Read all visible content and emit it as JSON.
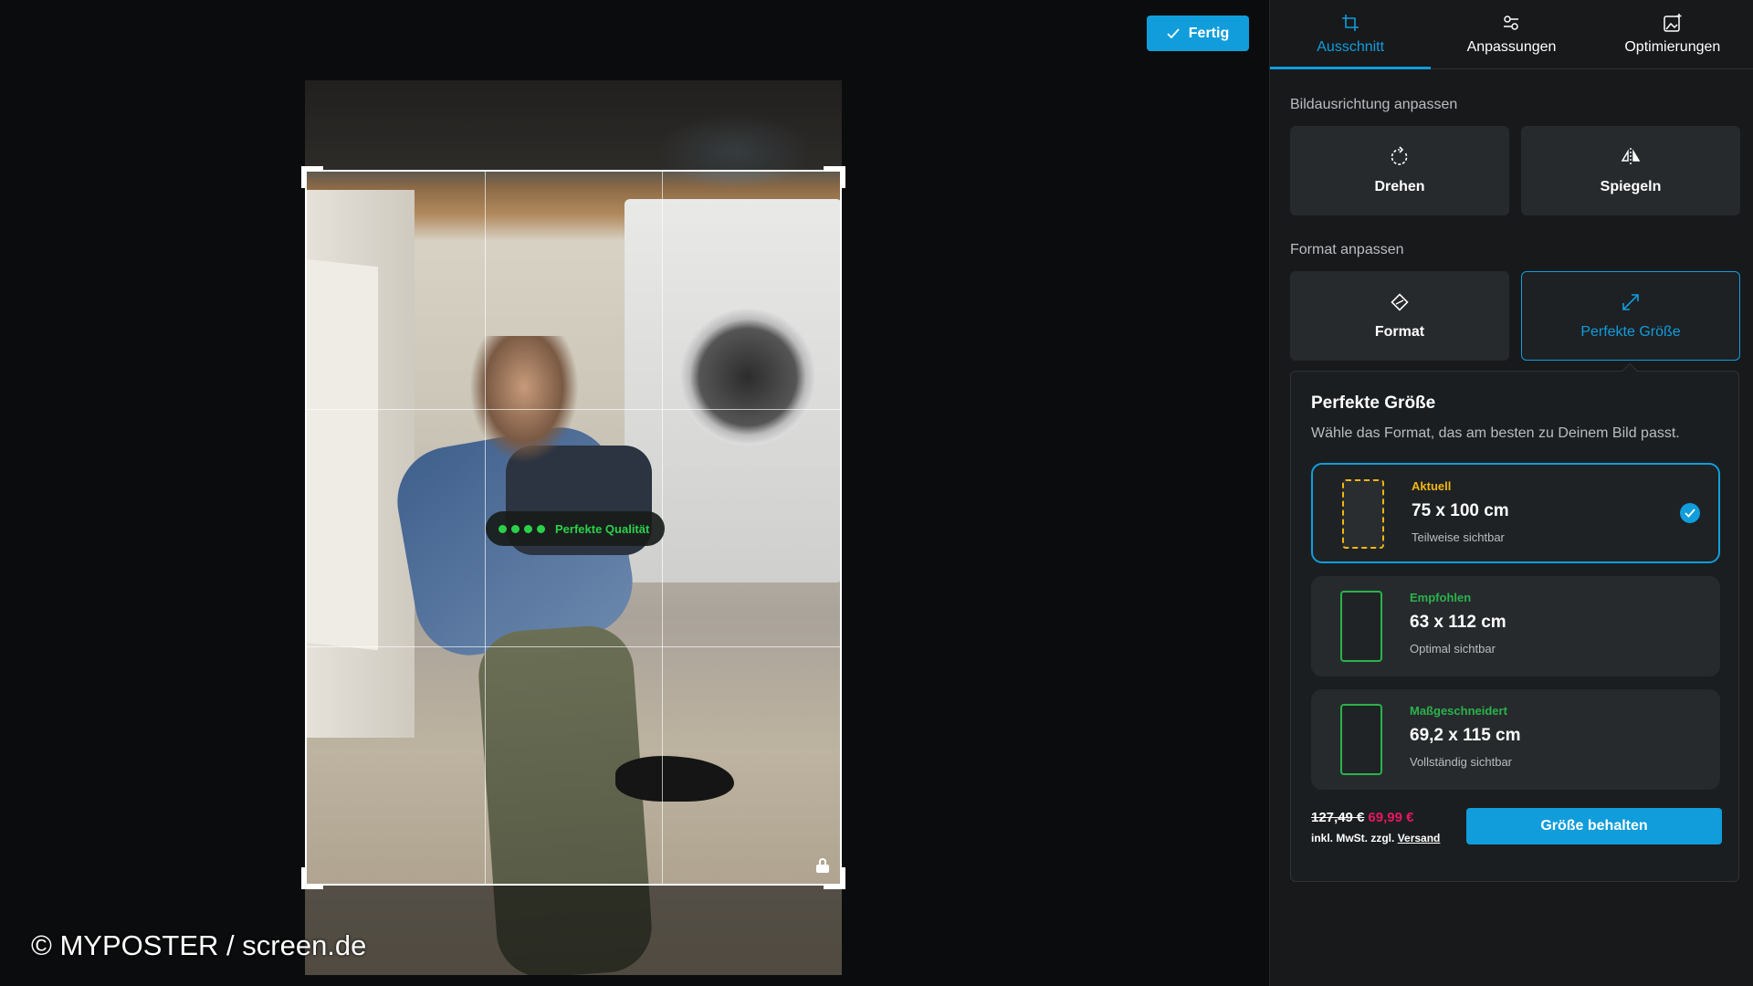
{
  "editor": {
    "done_label": "Fertig",
    "quality_label": "Perfekte Qualität",
    "watermark": "© MYPOSTER / screen.de"
  },
  "tabs": [
    {
      "label": "Ausschnitt",
      "icon": "crop-icon",
      "active": true
    },
    {
      "label": "Anpassungen",
      "icon": "sliders-icon",
      "active": false
    },
    {
      "label": "Optimierungen",
      "icon": "image-magic-icon",
      "active": false
    }
  ],
  "orientation": {
    "title": "Bildausrichtung anpassen",
    "rotate_label": "Drehen",
    "mirror_label": "Spiegeln"
  },
  "format": {
    "title": "Format anpassen",
    "format_label": "Format",
    "perfect_label": "Perfekte Größe"
  },
  "perfect_size": {
    "title": "Perfekte Größe",
    "subtitle": "Wähle das Format, das am besten zu Deinem Bild passt.",
    "options": [
      {
        "tag": "Aktuell",
        "size": "75 x 100 cm",
        "note": "Teilweise sichtbar",
        "tag_color": "#f2b70f",
        "selected": true
      },
      {
        "tag": "Empfohlen",
        "size": "63 x 112 cm",
        "note": "Optimal sichtbar",
        "tag_color": "#2bb24c",
        "selected": false
      },
      {
        "tag": "Maßgeschneidert",
        "size": "69,2 x 115 cm",
        "note": "Vollständig sichtbar",
        "tag_color": "#2bb24c",
        "selected": false
      }
    ],
    "price_old": "127,49 €",
    "price_new": "69,99 €",
    "tax_text": "inkl. MwSt. zzgl.",
    "shipping_link": "Versand",
    "keep_button": "Größe behalten"
  },
  "colors": {
    "accent": "#119ddb",
    "current": "#f2b70f",
    "recommended": "#2bb24c",
    "sale": "#e6175f"
  }
}
